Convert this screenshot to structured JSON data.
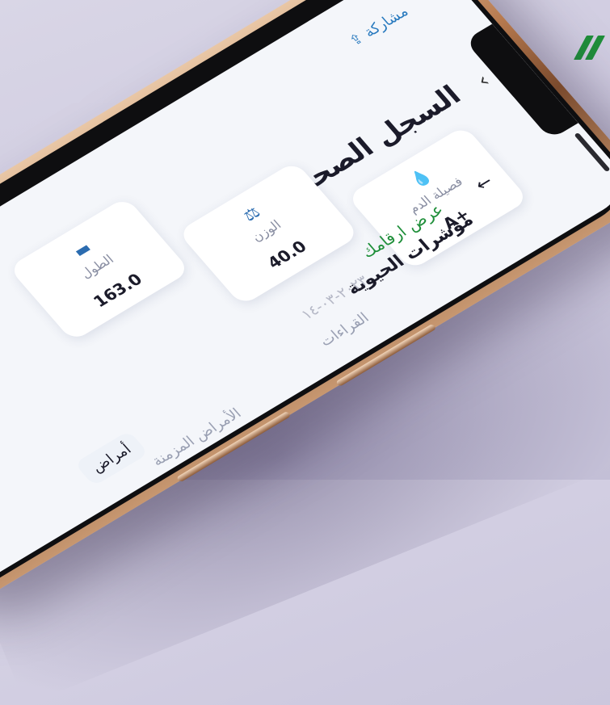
{
  "app": {
    "header_title": "السجل الصحي",
    "share_label": "مشاركة"
  },
  "vitals": [
    {
      "label": "فصيلة الدم",
      "value": "A+",
      "icon": "drop-icon"
    },
    {
      "label": "الوزن",
      "value": "40.0",
      "icon": "scale-icon"
    },
    {
      "label": "الطول",
      "value": "163.0",
      "icon": "ruler-icon"
    }
  ],
  "sections": {
    "green_link": "عرض ارقامك",
    "vital_signs_title": "مؤشرات الحيوية",
    "vital_signs_date": "٢٠٢٣-٠٣-١٤",
    "readings_label": "القراءات",
    "chronic_label": "الأمراض المزمنة",
    "chip_label": "أمراض"
  },
  "colors": {
    "accent_green": "#1f8f3a",
    "phone_gold": "#b77a4f",
    "background": "#d6d2e4"
  }
}
